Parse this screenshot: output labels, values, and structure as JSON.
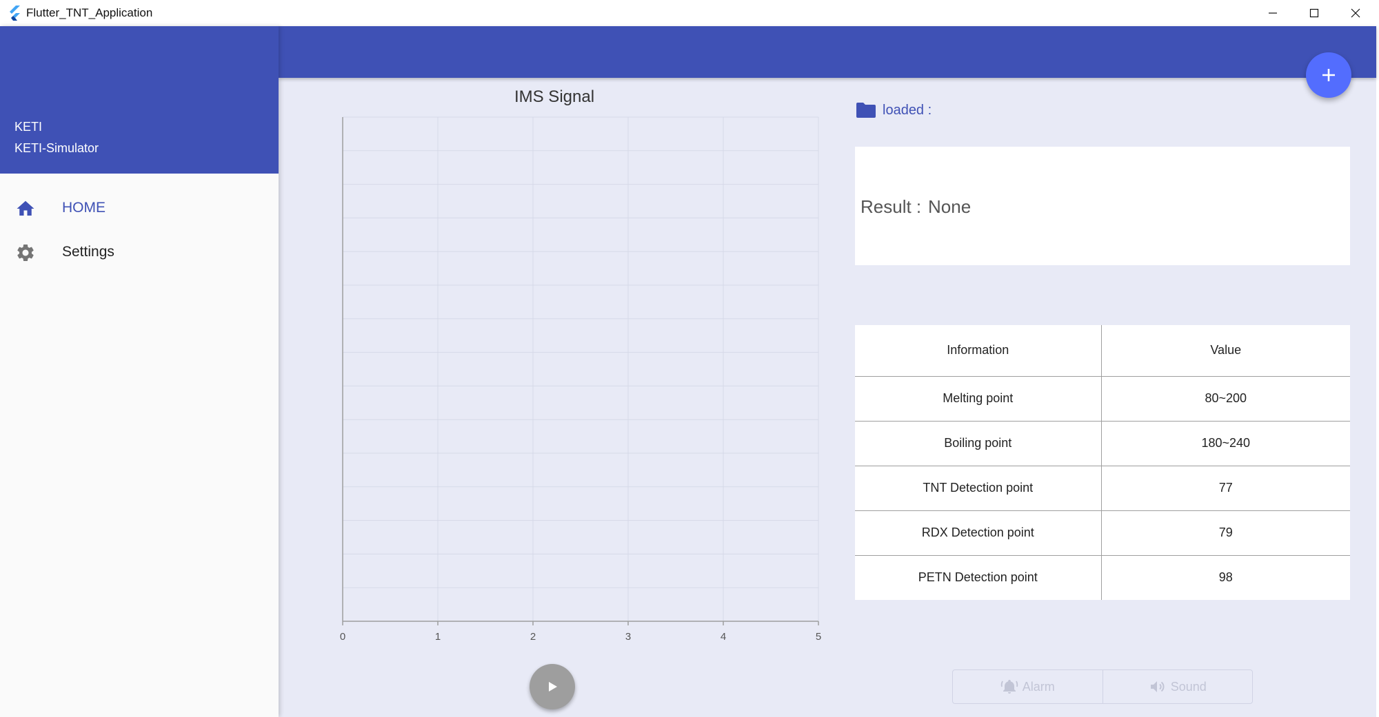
{
  "window": {
    "title": "Flutter_TNT_Application"
  },
  "drawer": {
    "header_line1": "KETI",
    "header_line2": "KETI-Simulator",
    "items": [
      {
        "label": "HOME",
        "icon": "home-icon",
        "selected": true
      },
      {
        "label": "Settings",
        "icon": "gear-icon",
        "selected": false
      }
    ]
  },
  "colors": {
    "primary": "#3f51b5",
    "fab": "#536dfe",
    "background": "#e8eaf6",
    "play_button": "#9e9e9e"
  },
  "chart": {
    "title": "IMS Signal"
  },
  "chart_data": {
    "type": "line",
    "title": "IMS Signal",
    "xlabel": "",
    "ylabel": "",
    "x_ticks": [
      "0",
      "1",
      "2",
      "3",
      "4",
      "5"
    ],
    "xlim": [
      0,
      5
    ],
    "grid": true,
    "series": []
  },
  "file": {
    "loaded_label": "loaded :"
  },
  "result": {
    "label": "Result :",
    "value": "None"
  },
  "table": {
    "headers": [
      "Information",
      "Value"
    ],
    "rows": [
      [
        "Melting point",
        "80~200"
      ],
      [
        "Boiling point",
        "180~240"
      ],
      [
        "TNT Detection point",
        "77"
      ],
      [
        "RDX Detection point",
        "79"
      ],
      [
        "PETN Detection point",
        "98"
      ]
    ]
  },
  "toggles": {
    "alarm_label": "Alarm",
    "sound_label": "Sound"
  }
}
